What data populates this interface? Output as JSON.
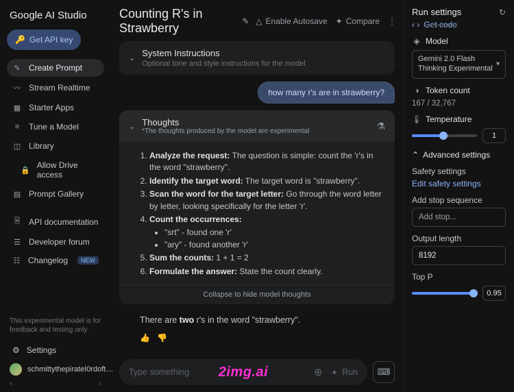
{
  "app": {
    "name": "Google AI Studio"
  },
  "sidebar": {
    "api_key_btn": "Get API key",
    "items": [
      {
        "label": "Create Prompt"
      },
      {
        "label": "Stream Realtime"
      },
      {
        "label": "Starter Apps"
      },
      {
        "label": "Tune a Model"
      },
      {
        "label": "Library"
      },
      {
        "label": "Allow Drive access"
      },
      {
        "label": "Prompt Gallery"
      }
    ],
    "secondary": [
      {
        "label": "API documentation"
      },
      {
        "label": "Developer forum"
      },
      {
        "label": "Changelog",
        "badge": "NEW"
      }
    ],
    "footer_note": "This experimental model is for feedback and testing only.",
    "settings_label": "Settings",
    "username": "schmittythepirateI0rdoft…"
  },
  "header": {
    "title": "Counting R's in Strawberry",
    "autosave": "Enable Autosave",
    "compare": "Compare"
  },
  "system_box": {
    "title": "System Instructions",
    "subtitle": "Optional tone and style instructions for the model"
  },
  "conversation": {
    "user_msg": "how many r's are in strawberry?",
    "thoughts": {
      "title": "Thoughts",
      "subtitle": "*The thoughts produced by the model are experimental",
      "steps": [
        {
          "b": "Analyze the request:",
          "t": " The question is simple: count the 'r's in the word \"strawberry\"."
        },
        {
          "b": "Identify the target word:",
          "t": " The target word is \"strawberry\"."
        },
        {
          "b": "Scan the word for the target letter:",
          "t": " Go through the word letter by letter, looking specifically for the letter 'r'."
        },
        {
          "b": "Count the occurrences:",
          "t": "",
          "sub": [
            "\"srt\" - found one 'r'",
            "\"ary\" - found another 'r'"
          ]
        },
        {
          "b": "Sum the counts:",
          "t": " 1 + 1 = 2"
        },
        {
          "b": "Formulate the answer:",
          "t": " State the count clearly."
        }
      ],
      "collapse": "Collapse to hide model thoughts"
    },
    "answer_pre": "There are ",
    "answer_bold": "two",
    "answer_post": " r's in the word \"strawberry\"."
  },
  "input": {
    "placeholder": "Type something",
    "run": "Run",
    "watermark": "2img.ai"
  },
  "runpanel": {
    "title": "Run settings",
    "getcode": "Get code",
    "model_label": "Model",
    "model_value": "Gemini 2.0 Flash Thinking Experimental",
    "token_label": "Token count",
    "token_value": "167 / 32,767",
    "temp_label": "Temperature",
    "temp_value": "1",
    "adv_label": "Advanced settings",
    "safety_label": "Safety settings",
    "safety_link": "Edit safety settings",
    "stop_label": "Add stop sequence",
    "stop_placeholder": "Add stop...",
    "outlen_label": "Output length",
    "outlen_value": "8192",
    "topp_label": "Top P",
    "topp_value": "0.95"
  }
}
